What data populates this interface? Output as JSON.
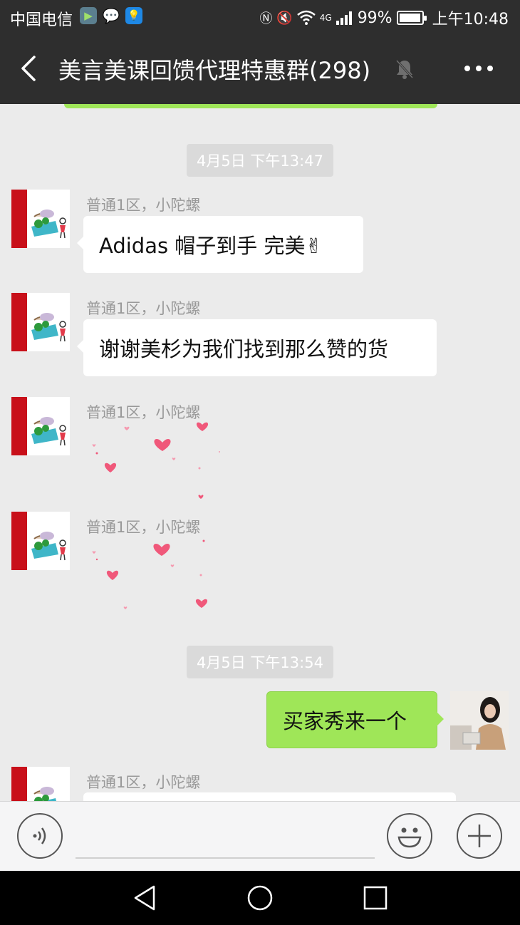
{
  "status_bar": {
    "carrier": "中国电信",
    "signal_text": "4G",
    "battery_percent": "99%",
    "battery_level": 0.99,
    "time": "上午10:48"
  },
  "header": {
    "title": "美言美课回馈代理特惠群(298)"
  },
  "messages": {
    "timestamp_1": "4月5日 下午13:47",
    "sender": "普通1区，小陀螺",
    "msg1_text": "Adidas 帽子到手 完美✌",
    "msg2_text": "谢谢美杉为我们找到那么赞的货",
    "timestamp_2": "4月5日 下午13:54",
    "my_msg_text": "买家秀来一个"
  },
  "input_bar": {
    "placeholder": ""
  },
  "colors": {
    "header_bg": "#2e2e2e",
    "chat_bg": "#ebebeb",
    "my_bubble": "#9fe658",
    "heart": "#f0587a"
  }
}
